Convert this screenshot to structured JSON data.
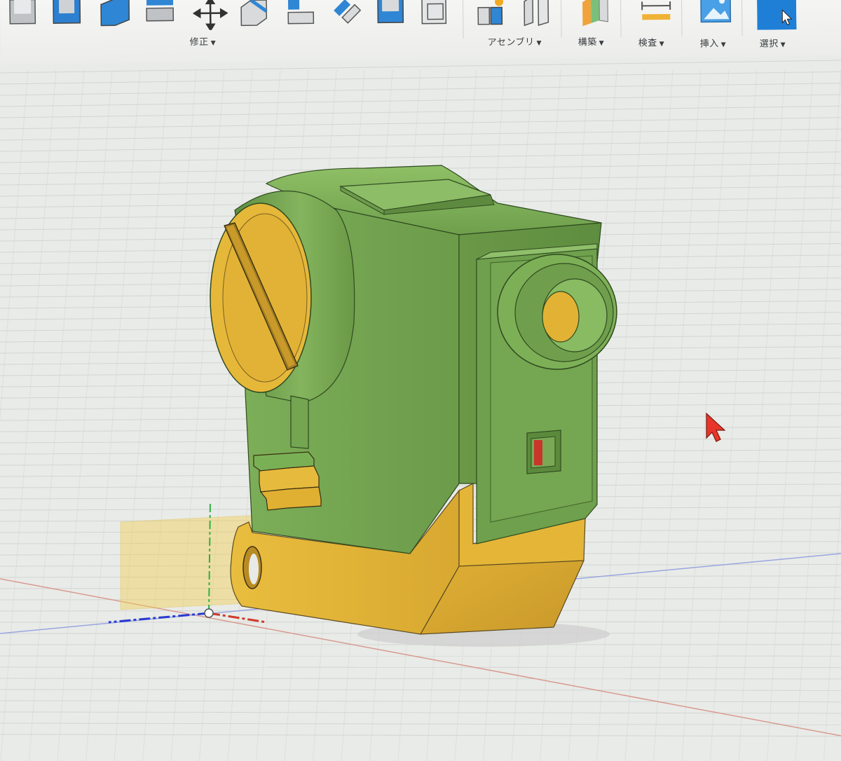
{
  "toolbar": {
    "groups": [
      {
        "label": "修正"
      },
      {
        "label": "アセンブリ"
      },
      {
        "label": "構築"
      },
      {
        "label": "検査"
      },
      {
        "label": "挿入"
      },
      {
        "label": "選択"
      }
    ]
  },
  "colors": {
    "body_green": "#79a955",
    "body_green_dark": "#5c8a3e",
    "body_yellow": "#e6b638",
    "body_yellow_dark": "#c89528",
    "grid_line": "#cfd2cf",
    "axis_blue": "#3a4ed0",
    "axis_red": "#c84a3a",
    "axis_green": "#38b045",
    "select_blue": "#1f7fd6",
    "cursor_red": "#e8352b"
  },
  "icons": {
    "modify": "move-icon",
    "assembly": "assembly-icon",
    "construct": "construct-plane-icon",
    "inspect": "measure-icon",
    "insert": "insert-image-icon",
    "select": "select-cursor-icon"
  }
}
